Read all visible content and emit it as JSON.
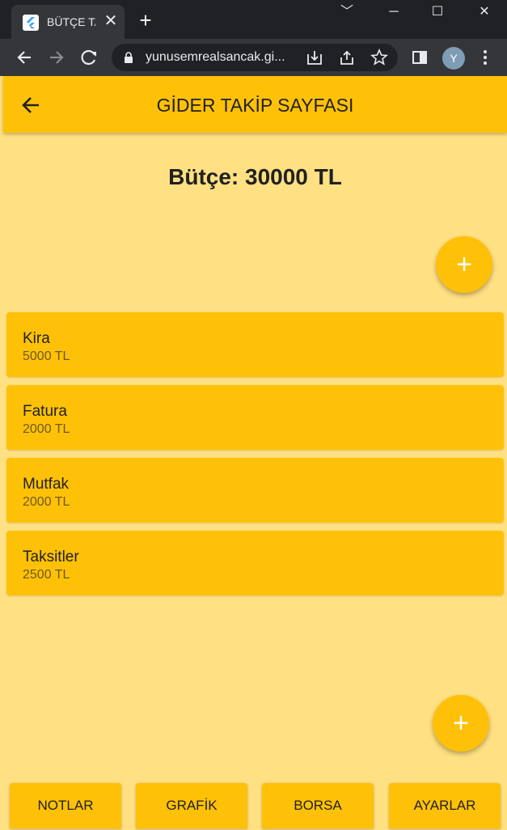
{
  "browser": {
    "tab_title": "BÜTÇE TA",
    "tab_close": "✕",
    "new_tab": "+",
    "url": "yunusemrealsancak.gi...",
    "avatar_initial": "Y",
    "window_controls": {
      "minimize": "﹀",
      "restore": "─",
      "maximize": "☐",
      "close": "✕"
    }
  },
  "app": {
    "title": "GİDER TAKİP SAYFASI",
    "budget_label": "Bütçe: 30000 TL",
    "fab_icon": "+",
    "expenses": [
      {
        "name": "Kira",
        "amount": "5000 TL"
      },
      {
        "name": "Fatura",
        "amount": "2000 TL"
      },
      {
        "name": "Mutfak",
        "amount": "2000 TL"
      },
      {
        "name": "Taksitler",
        "amount": "2500 TL"
      }
    ],
    "bottom_nav": [
      "NOTLAR",
      "GRAFİK",
      "BORSA",
      "AYARLAR"
    ]
  },
  "colors": {
    "primary": "#ffc107",
    "background": "#ffe082",
    "browser_dark": "#202124"
  }
}
